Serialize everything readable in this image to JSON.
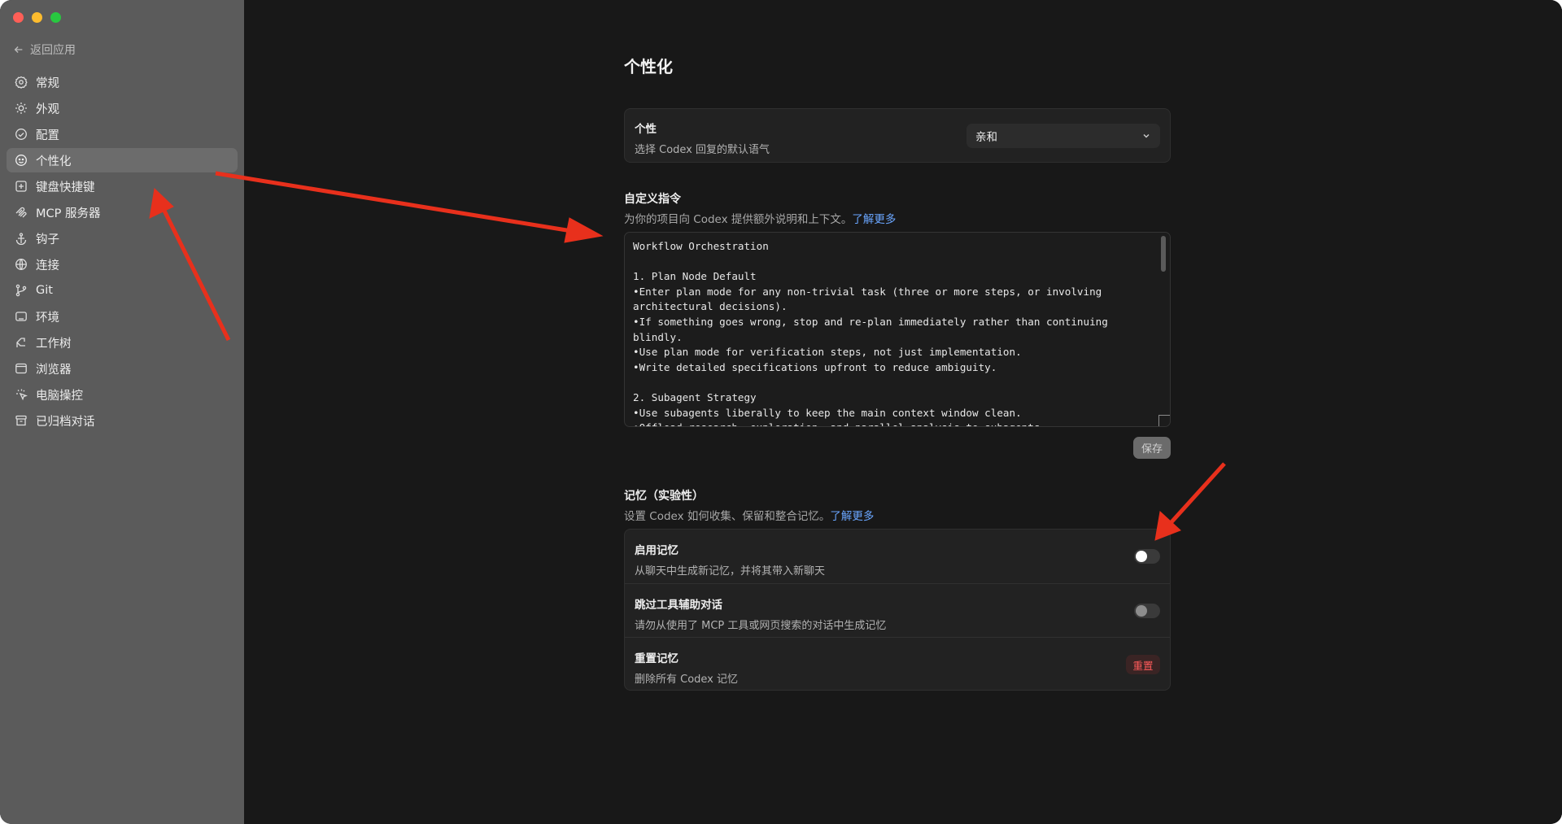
{
  "sidebar": {
    "back_label": "返回应用",
    "items": [
      {
        "label": "常规",
        "icon": "gear-icon"
      },
      {
        "label": "外观",
        "icon": "sun-icon"
      },
      {
        "label": "配置",
        "icon": "config-icon"
      },
      {
        "label": "个性化",
        "icon": "personality-icon",
        "active": true
      },
      {
        "label": "键盘快捷键",
        "icon": "keyboard-icon"
      },
      {
        "label": "MCP 服务器",
        "icon": "mcp-icon"
      },
      {
        "label": "钩子",
        "icon": "anchor-icon"
      },
      {
        "label": "连接",
        "icon": "globe-icon"
      },
      {
        "label": "Git",
        "icon": "git-branch-icon"
      },
      {
        "label": "环境",
        "icon": "terminal-icon"
      },
      {
        "label": "工作树",
        "icon": "worktree-icon"
      },
      {
        "label": "浏览器",
        "icon": "browser-icon"
      },
      {
        "label": "电脑操控",
        "icon": "cursor-icon"
      },
      {
        "label": "已归档对话",
        "icon": "archive-icon"
      }
    ]
  },
  "page": {
    "title": "个性化",
    "personality": {
      "title": "个性",
      "desc": "选择 Codex 回复的默认语气",
      "selected": "亲和"
    },
    "custom": {
      "title": "自定义指令",
      "desc": "为你的项目向 Codex 提供额外说明和上下文。",
      "link": "了解更多",
      "text": "Workflow Orchestration\n\n1. Plan Node Default\n•Enter plan mode for any non-trivial task (three or more steps, or involving architectural decisions).\n•If something goes wrong, stop and re-plan immediately rather than continuing blindly.\n•Use plan mode for verification steps, not just implementation.\n•Write detailed specifications upfront to reduce ambiguity.\n\n2. Subagent Strategy\n•Use subagents liberally to keep the main context window clean.\n•Offload research, exploration, and parallel analysis to subagents.",
      "save": "保存"
    },
    "memory": {
      "title": "记忆（实验性）",
      "desc": "设置 Codex 如何收集、保留和整合记忆。",
      "link": "了解更多",
      "rows": [
        {
          "title": "启用记忆",
          "desc": "从聊天中生成新记忆，并将其带入新聊天",
          "enabled": false
        },
        {
          "title": "跳过工具辅助对话",
          "desc": "请勿从使用了 MCP 工具或网页搜索的对话中生成记忆",
          "enabled": false
        },
        {
          "title": "重置记忆",
          "desc": "删除所有 Codex 记忆",
          "button": "重置"
        }
      ]
    }
  },
  "colors": {
    "accent_link": "#6aa6ff",
    "danger": "#ff5a5a",
    "annotation_arrow": "#e8301c"
  }
}
